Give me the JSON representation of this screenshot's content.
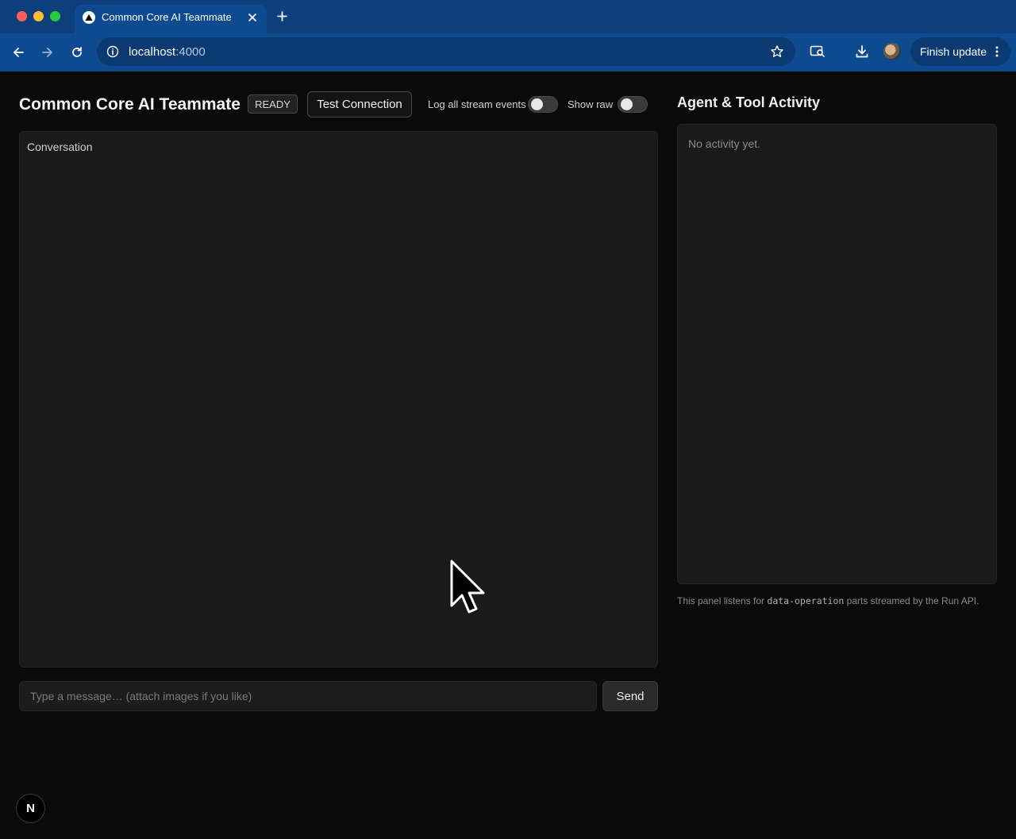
{
  "browser": {
    "tab_title": "Common Core AI Teammate",
    "url_host": "localhost",
    "url_port": ":4000",
    "finish_update_label": "Finish update",
    "icons": {
      "back": "arrow-left-icon",
      "forward": "arrow-right-icon",
      "reload": "reload-icon",
      "site_info": "info-icon",
      "bookmark": "star-icon",
      "lens": "search-page-icon",
      "download": "download-icon",
      "menu": "more-vertical-icon"
    },
    "colors": {
      "tabstrip": "#0d3f7c",
      "toolbar": "#0e4a8f"
    }
  },
  "header": {
    "title": "Common Core AI Teammate",
    "status": "READY",
    "test_connection_label": "Test Connection",
    "toggles": [
      {
        "label": "Log all stream events",
        "on": false
      },
      {
        "label": "Show raw",
        "on": false
      }
    ]
  },
  "conversation": {
    "label": "Conversation"
  },
  "composer": {
    "placeholder": "Type a message… (attach images if you like)",
    "send_label": "Send"
  },
  "activity": {
    "title": "Agent & Tool Activity",
    "empty_text": "No activity yet.",
    "note_prefix": "This panel listens for ",
    "note_code": "data-operation",
    "note_suffix": " parts streamed by the Run API."
  },
  "dev_badge": {
    "letter": "N"
  }
}
